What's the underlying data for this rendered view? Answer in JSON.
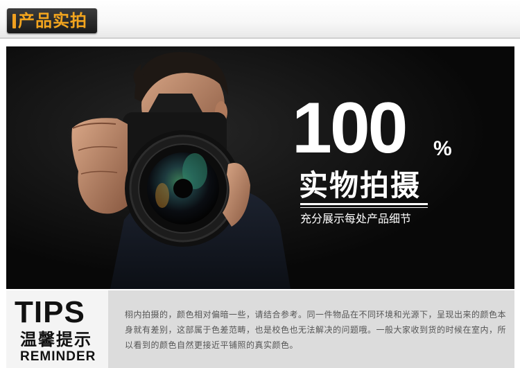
{
  "header": {
    "title": "产品实拍",
    "accent_color": "#f3a51e"
  },
  "banner": {
    "big_number": "100",
    "percent": "%",
    "headline": "实物拍摄",
    "subline": "充分展示每处产品细节",
    "image_description_icon": "photographer-with-camera"
  },
  "tips": {
    "title": "TIPS",
    "title_cn": "温馨提示",
    "title_en": "REMINDER",
    "text": "栩内拍摄的，颜色相对偏暗一些，请结合参考。同一件物品在不同环境和光源下，呈现出来的颜色本身就有差别，这部属于色差范畴，也是校色也无法解决的问题哦。一般大家收到货的时候在室内，所以看到的颜色自然更接近平铺照的真实颜色。"
  }
}
